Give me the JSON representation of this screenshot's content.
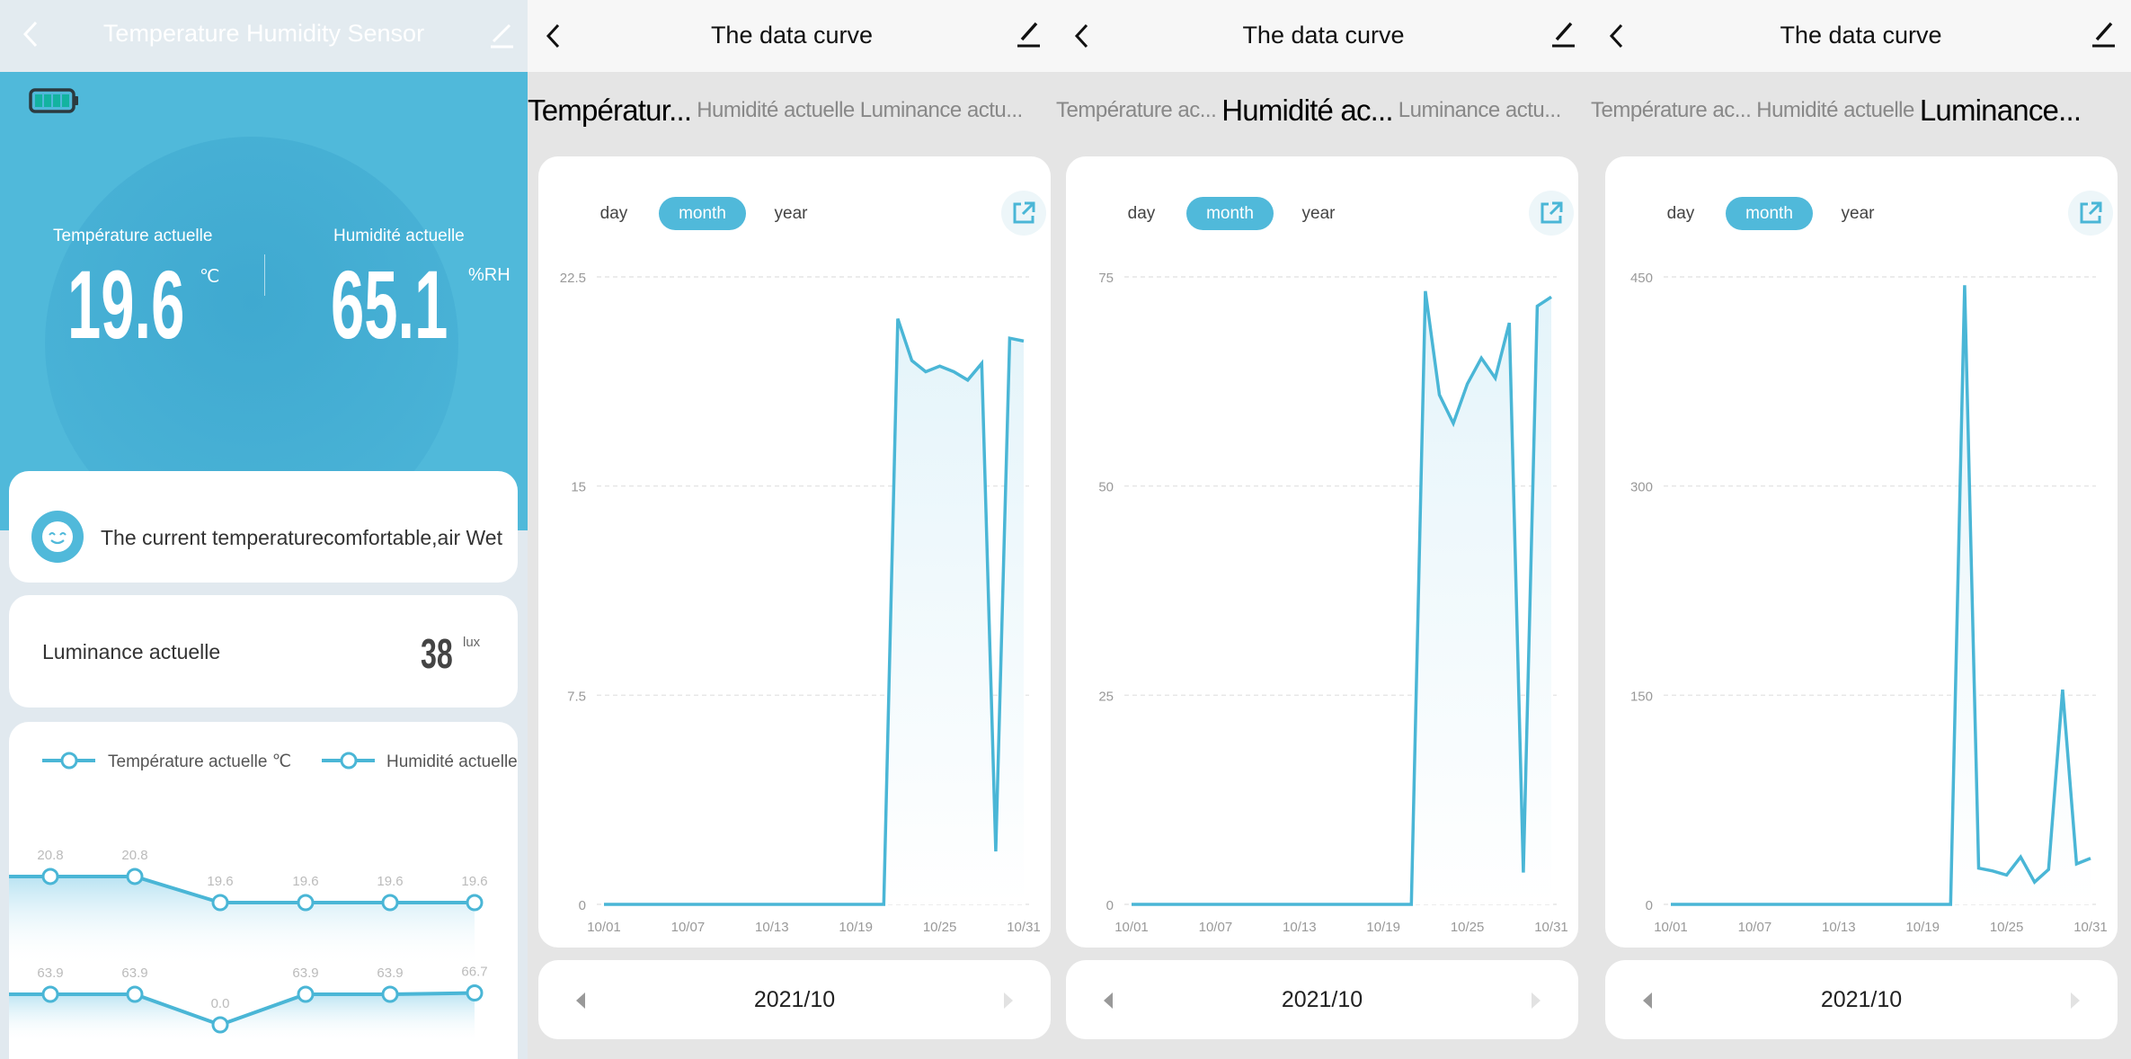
{
  "colors": {
    "accent": "#50b9da",
    "line": "#4ab6d6",
    "battery": "#13b3a0"
  },
  "home": {
    "title": "Temperature Humidity Sensor",
    "battery_icon": "battery-full-icon",
    "temperature": {
      "label": "Température actuelle",
      "value": "19.6",
      "unit": "℃"
    },
    "humidity": {
      "label": "Humidité actuelle",
      "value": "65.1",
      "unit": "%RH"
    },
    "comfort_message": "The current temperaturecomfortable,air Wet",
    "luminance": {
      "label": "Luminance actuelle",
      "value": "38",
      "unit": "lux"
    },
    "legend": [
      "Température actuelle ℃",
      "Humidité actuelle"
    ]
  },
  "curve_screens": [
    {
      "title": "The data curve",
      "tabs": [
        "Températur...",
        "Humidité actuelle",
        "Luminance actu..."
      ],
      "active_tab": 0,
      "ranges": [
        "day",
        "month",
        "year"
      ],
      "active_range": 1,
      "date": "2021/10"
    },
    {
      "title": "The data curve",
      "tabs": [
        "Température ac...",
        "Humidité ac...",
        "Luminance actu..."
      ],
      "active_tab": 1,
      "ranges": [
        "day",
        "month",
        "year"
      ],
      "active_range": 1,
      "date": "2021/10"
    },
    {
      "title": "The data curve",
      "tabs": [
        "Température ac...",
        "Humidité actuelle",
        "Luminance..."
      ],
      "active_tab": 2,
      "ranges": [
        "day",
        "month",
        "year"
      ],
      "active_range": 1,
      "date": "2021/10"
    }
  ],
  "chart_data": [
    {
      "type": "line",
      "title": "",
      "series": [
        {
          "name": "Température actuelle ℃",
          "values": [
            20.8,
            20.8,
            19.6,
            19.6,
            19.6,
            19.6
          ],
          "labels": [
            "20.8",
            "20.8",
            "19.6",
            "19.6",
            "19.6",
            "19.6"
          ]
        },
        {
          "name": "Humidité actuelle",
          "values": [
            63.9,
            63.9,
            0.0,
            63.9,
            63.9,
            66.7
          ],
          "labels": [
            "63.9",
            "63.9",
            "0.0",
            "63.9",
            "63.9",
            "66.7"
          ]
        }
      ]
    },
    {
      "type": "area",
      "xlabel": "",
      "ylabel": "",
      "ylim": [
        0,
        22.5
      ],
      "yticks": [
        "0",
        "7.5",
        "15",
        "22.5"
      ],
      "yticks_values": [
        0,
        7.5,
        15,
        22.5
      ],
      "xticks": [
        "10/01",
        "10/07",
        "10/13",
        "10/19",
        "10/25",
        "10/31"
      ],
      "grid": true,
      "x": [
        "10/01",
        "10/02",
        "10/03",
        "10/04",
        "10/05",
        "10/06",
        "10/07",
        "10/08",
        "10/09",
        "10/10",
        "10/11",
        "10/12",
        "10/13",
        "10/14",
        "10/15",
        "10/16",
        "10/17",
        "10/18",
        "10/19",
        "10/20",
        "10/21",
        "10/22",
        "10/23",
        "10/24",
        "10/25",
        "10/26",
        "10/27",
        "10/28",
        "10/29",
        "10/30",
        "10/31"
      ],
      "values": [
        0,
        0,
        0,
        0,
        0,
        0,
        0,
        0,
        0,
        0,
        0,
        0,
        0,
        0,
        0,
        0,
        0,
        0,
        0,
        0,
        0,
        21.0,
        19.5,
        19.1,
        19.3,
        19.1,
        18.8,
        19.4,
        1.9,
        20.3,
        20.2
      ]
    },
    {
      "type": "area",
      "xlabel": "",
      "ylabel": "",
      "ylim": [
        0,
        75
      ],
      "yticks": [
        "0",
        "25",
        "50",
        "75"
      ],
      "yticks_values": [
        0,
        25,
        50,
        75
      ],
      "xticks": [
        "10/01",
        "10/07",
        "10/13",
        "10/19",
        "10/25",
        "10/31"
      ],
      "grid": true,
      "x": [
        "10/01",
        "10/02",
        "10/03",
        "10/04",
        "10/05",
        "10/06",
        "10/07",
        "10/08",
        "10/09",
        "10/10",
        "10/11",
        "10/12",
        "10/13",
        "10/14",
        "10/15",
        "10/16",
        "10/17",
        "10/18",
        "10/19",
        "10/20",
        "10/21",
        "10/22",
        "10/23",
        "10/24",
        "10/25",
        "10/26",
        "10/27",
        "10/28",
        "10/29",
        "10/30",
        "10/31"
      ],
      "values": [
        0,
        0,
        0,
        0,
        0,
        0,
        0,
        0,
        0,
        0,
        0,
        0,
        0,
        0,
        0,
        0,
        0,
        0,
        0,
        0,
        0,
        73.3,
        60.9,
        57.5,
        62.2,
        65.3,
        62.9,
        69.5,
        3.8,
        71.5,
        72.6
      ]
    },
    {
      "type": "area",
      "xlabel": "",
      "ylabel": "",
      "ylim": [
        0,
        450
      ],
      "yticks": [
        "0",
        "150",
        "300",
        "450"
      ],
      "yticks_values": [
        0,
        150,
        300,
        450
      ],
      "xticks": [
        "10/01",
        "10/07",
        "10/13",
        "10/19",
        "10/25",
        "10/31"
      ],
      "grid": true,
      "x": [
        "10/01",
        "10/02",
        "10/03",
        "10/04",
        "10/05",
        "10/06",
        "10/07",
        "10/08",
        "10/09",
        "10/10",
        "10/11",
        "10/12",
        "10/13",
        "10/14",
        "10/15",
        "10/16",
        "10/17",
        "10/18",
        "10/19",
        "10/20",
        "10/21",
        "10/22",
        "10/23",
        "10/24",
        "10/25",
        "10/26",
        "10/27",
        "10/28",
        "10/29",
        "10/30",
        "10/31"
      ],
      "values": [
        0,
        0,
        0,
        0,
        0,
        0,
        0,
        0,
        0,
        0,
        0,
        0,
        0,
        0,
        0,
        0,
        0,
        0,
        0,
        0,
        0,
        444,
        26,
        24,
        21,
        34,
        16,
        25,
        154,
        29,
        33
      ]
    }
  ]
}
